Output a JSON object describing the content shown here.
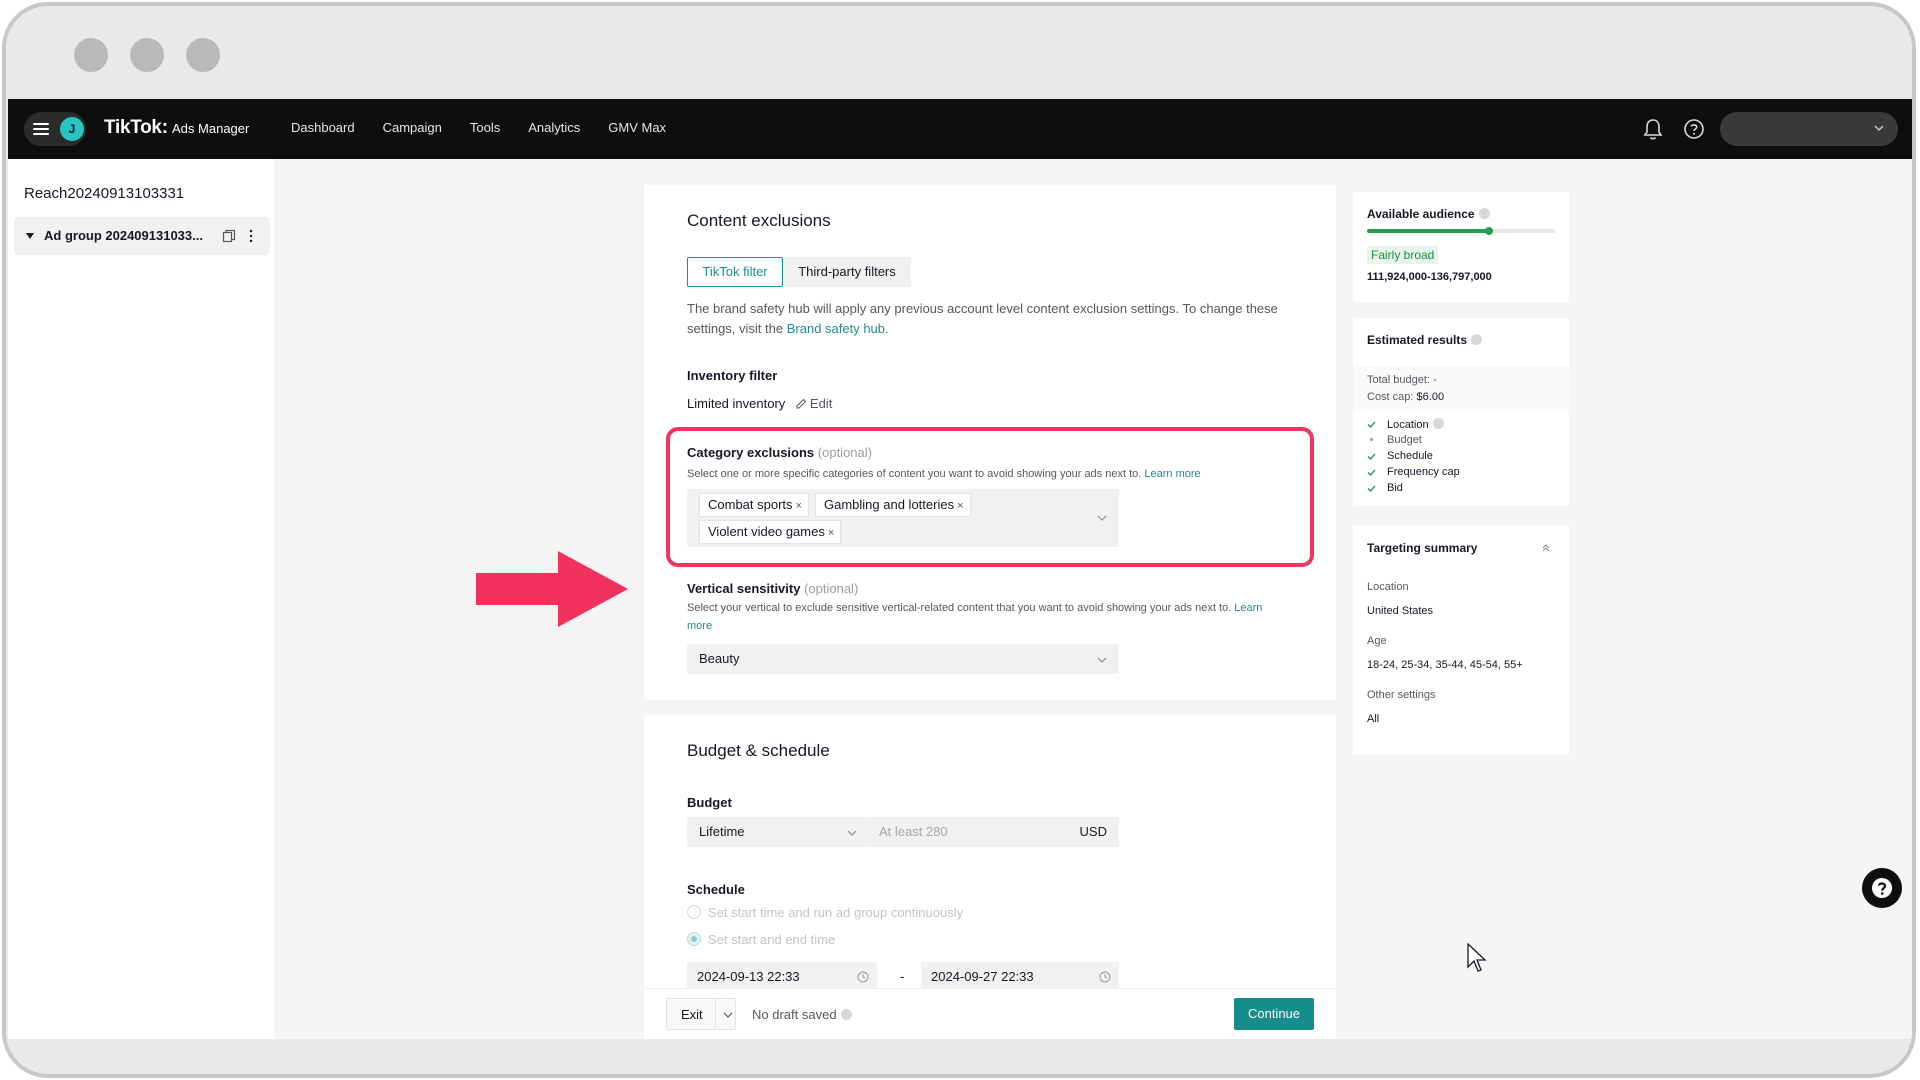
{
  "nav": {
    "avatar_initial": "J",
    "brand_main": "TikTok",
    "brand_sep": ":",
    "brand_sub": "Ads Manager",
    "links": [
      "Dashboard",
      "Campaign",
      "Tools",
      "Analytics",
      "GMV Max"
    ]
  },
  "sidebar": {
    "campaign_name": "Reach20240913103331",
    "ad_group_label": "Ad group 202409131033..."
  },
  "content_exclusions": {
    "title": "Content exclusions",
    "tabs": [
      {
        "label": "TikTok filter",
        "selected": true
      },
      {
        "label": "Third-party filters",
        "selected": false
      }
    ],
    "info_text": "The brand safety hub will apply any previous account level content exclusion settings. To change these settings, visit the",
    "info_link": "Brand safety hub",
    "info_end": ".",
    "inventory_filter_label": "Inventory filter",
    "inventory_filter_value": "Limited inventory",
    "edit_label": "Edit",
    "category_label": "Category exclusions",
    "optional": "(optional)",
    "category_desc": "Select one or more specific categories of content you want to avoid showing your ads next to.",
    "learn_more": "Learn more",
    "category_tags": [
      "Combat sports",
      "Gambling and lotteries",
      "Violent video games"
    ],
    "tag_remove": "×",
    "vertical_label": "Vertical sensitivity",
    "vertical_desc": "Select your vertical to exclude sensitive vertical-related content that you want to avoid showing your ads next to.",
    "vertical_learn": "Learn",
    "vertical_more": "more",
    "vertical_value": "Beauty"
  },
  "budget_schedule": {
    "title": "Budget & schedule",
    "budget_label": "Budget",
    "budget_type": "Lifetime",
    "budget_placeholder": "At least 280",
    "currency": "USD",
    "schedule_label": "Schedule",
    "radio_continuous": "Set start time and run ad group continuously",
    "radio_start_end": "Set start and end time",
    "start_time": "2024-09-13 22:33",
    "range_sep": "-",
    "end_time": "2024-09-27 22:33"
  },
  "footer": {
    "exit_label": "Exit",
    "draft_status": "No draft saved",
    "continue_label": "Continue"
  },
  "audience": {
    "title": "Available audience",
    "level_fraction": 0.65,
    "badge": "Fairly broad",
    "range": "111,924,000-136,797,000"
  },
  "estimated": {
    "title": "Estimated results",
    "total_budget_label": "Total budget:",
    "total_budget_value": "-",
    "cost_cap_label": "Cost cap:",
    "cost_cap_value": "$6.00",
    "checks": [
      {
        "label": "Location",
        "checked": true,
        "info": true
      },
      {
        "label": "Budget",
        "checked": false,
        "info": false
      },
      {
        "label": "Schedule",
        "checked": true,
        "info": false
      },
      {
        "label": "Frequency cap",
        "checked": true,
        "info": false
      },
      {
        "label": "Bid",
        "checked": true,
        "info": false
      }
    ]
  },
  "targeting": {
    "title": "Targeting summary",
    "location_label": "Location",
    "location_value": "United States",
    "age_label": "Age",
    "age_value": "18-24, 25-34, 35-44, 45-54, 55+",
    "other_label": "Other settings",
    "other_value": "All"
  },
  "colors": {
    "accent": "#168c8c",
    "highlight": "#ee3760",
    "nav_bg": "#0e0e0e",
    "audience_green": "#22a04b"
  },
  "icons": [
    "hamburger-icon",
    "bell-icon",
    "help-icon",
    "chevron-down-icon",
    "copy-icon",
    "more-vertical-icon",
    "edit-icon",
    "close-icon",
    "clock-icon",
    "check-icon",
    "info-icon",
    "chevron-up-icon",
    "mouse-cursor-icon",
    "arrow-right-icon"
  ]
}
